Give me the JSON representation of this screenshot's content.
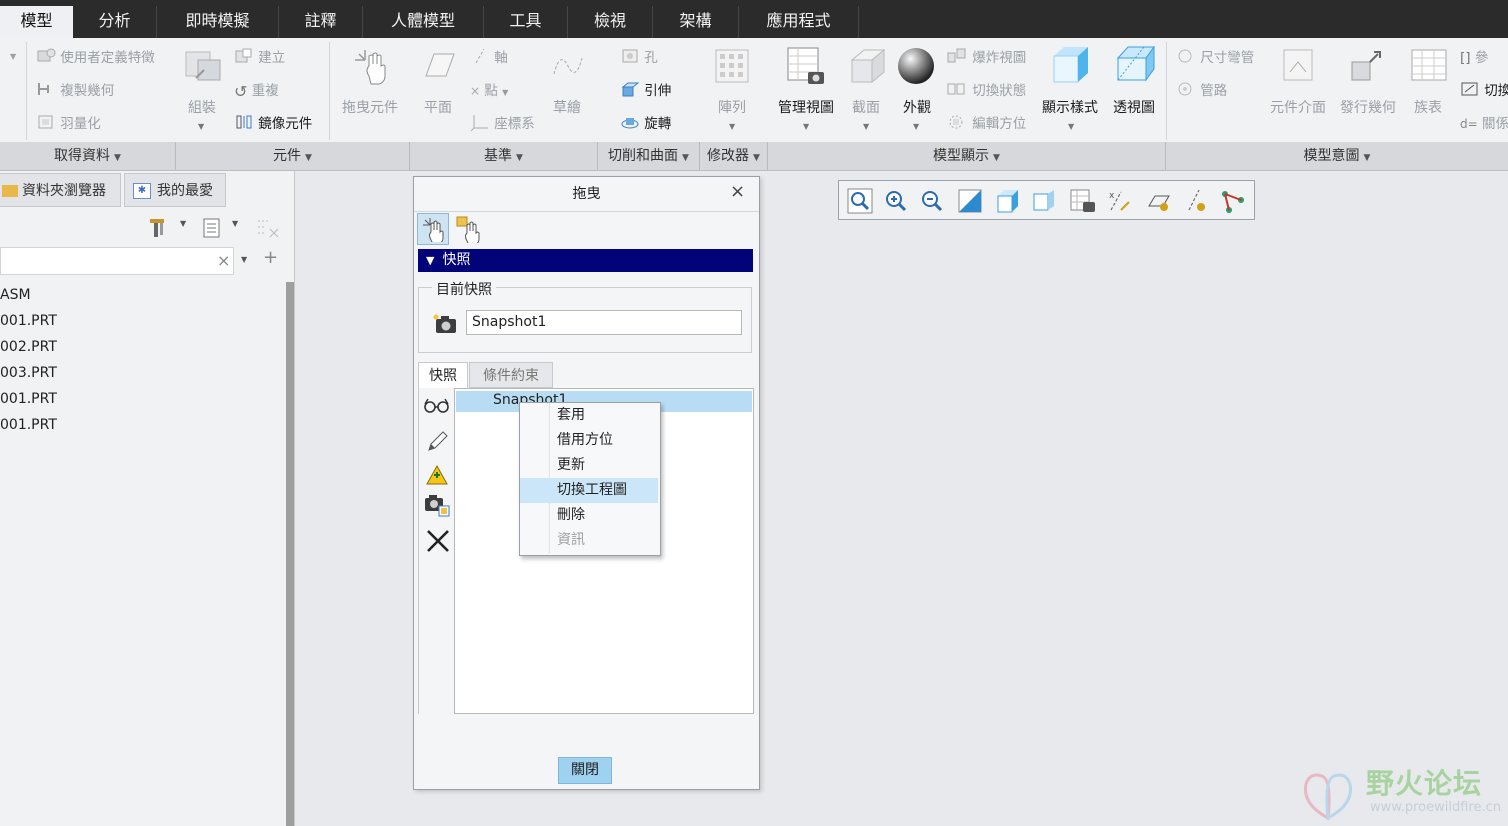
{
  "tabs": [
    "模型",
    "分析",
    "即時模擬",
    "註釋",
    "人體模型",
    "工具",
    "檢視",
    "架構",
    "應用程式"
  ],
  "ribbon": {
    "get_data": {
      "items": [
        "使用者定義特徵",
        "複製幾何",
        "羽量化"
      ],
      "group": "取得資料"
    },
    "component": {
      "assemble": "組裝",
      "create": "建立",
      "repeat": "重複",
      "mirror": "鏡像元件",
      "drag": "拖曳元件",
      "group": "元件"
    },
    "datum": {
      "plane": "平面",
      "axis": "軸",
      "point": "點",
      "csys": "座標系",
      "sketch": "草繪",
      "group": "基準"
    },
    "cut_surface": {
      "hole": "孔",
      "extrude": "引伸",
      "revolve": "旋轉",
      "group": "切削和曲面"
    },
    "modifier": {
      "pattern": "陣列",
      "group": "修改器"
    },
    "model_display": {
      "manage_views": "管理視圖",
      "section": "截面",
      "appearance": "外觀",
      "exploded": "爆炸視圖",
      "toggle_state": "切換狀態",
      "edit_position": "編輯方位",
      "display_style": "顯示樣式",
      "perspective": "透視圖",
      "group": "模型顯示"
    },
    "model_intent": {
      "dim_bend": "尺寸彎管",
      "pipe": "管路",
      "comp_interface": "元件介面",
      "publish_geom": "發行幾何",
      "family_table": "族表",
      "param": "參",
      "switch": "切換",
      "relation": "關係",
      "group": "模型意圖"
    }
  },
  "left_panel": {
    "tabs": [
      "資料夾瀏覽器",
      "我的最愛"
    ],
    "tree": [
      "ASM",
      "001.PRT",
      "002.PRT",
      "003.PRT",
      "001.PRT",
      "001.PRT"
    ]
  },
  "dialog": {
    "title": "拖曳",
    "close_symbol": "×",
    "section": "快照",
    "current_snapshot_label": "目前快照",
    "current_snapshot_value": "Snapshot1",
    "tabs": [
      "快照",
      "條件約束"
    ],
    "list": [
      "Snapshot1"
    ],
    "close_button": "關閉"
  },
  "context_menu": [
    {
      "label": "套用",
      "enabled": true
    },
    {
      "label": "借用方位",
      "enabled": true
    },
    {
      "label": "更新",
      "enabled": true
    },
    {
      "label": "切換工程圖",
      "enabled": true,
      "highlighted": true
    },
    {
      "label": "刪除",
      "enabled": true
    },
    {
      "label": "資訊",
      "enabled": false
    }
  ],
  "watermark": {
    "name": "野火论坛",
    "url": "www.proewildfire.cn"
  },
  "colors": {
    "accent_bar": "#030379",
    "selection": "#b8dcf3",
    "menu_highlight": "#cbe6f8",
    "close_button": "#9fd2f1"
  }
}
